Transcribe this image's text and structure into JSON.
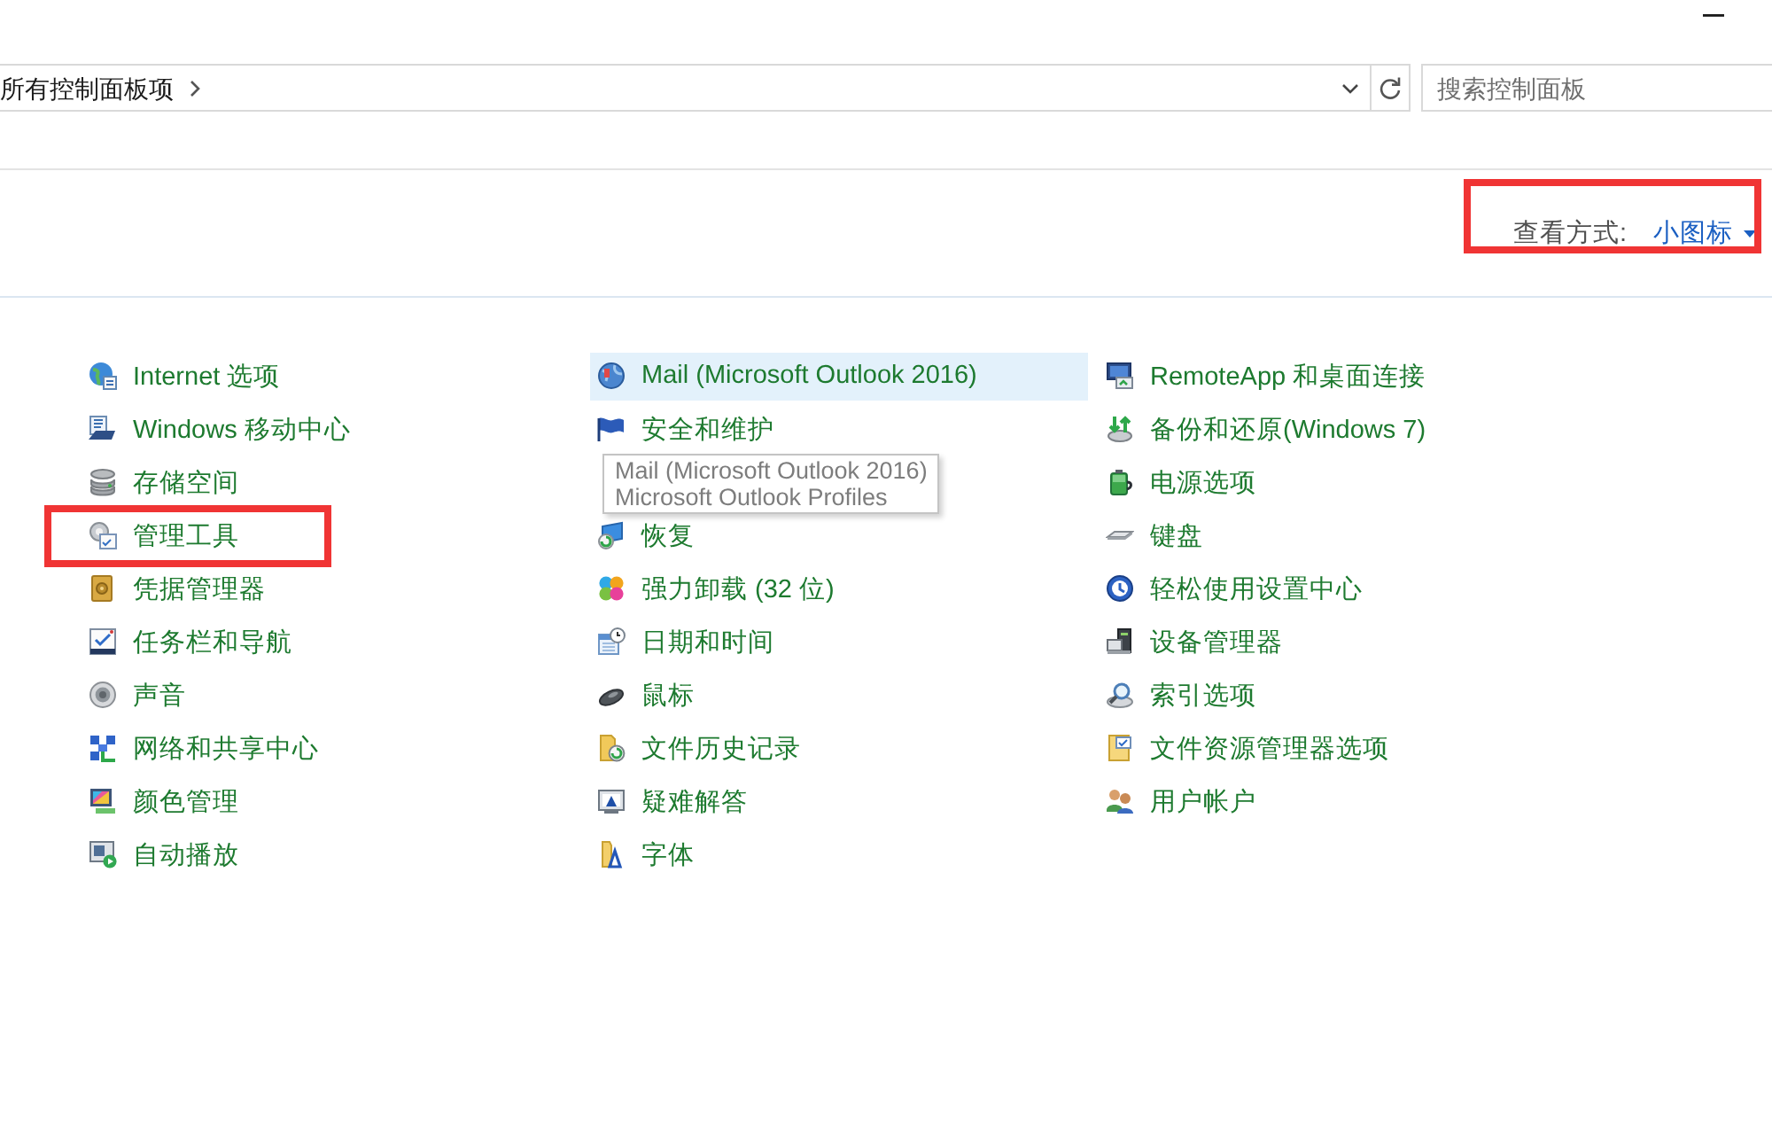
{
  "address_bar": {
    "breadcrumb": "所有控制面板项"
  },
  "search": {
    "placeholder": "搜索控制面板"
  },
  "view_by": {
    "label": "查看方式:",
    "value": "小图标",
    "marked": true
  },
  "columns": [
    {
      "items": [
        {
          "kind": "link",
          "label": "Internet 选项",
          "highlighted": false,
          "marked": false
        },
        {
          "kind": "link",
          "label": "Windows 移动中心",
          "highlighted": false,
          "marked": false
        },
        {
          "kind": "link",
          "label": "存储空间",
          "highlighted": false,
          "marked": false
        },
        {
          "kind": "link",
          "label": "管理工具",
          "highlighted": false,
          "marked": true
        },
        {
          "kind": "link",
          "label": "凭据管理器",
          "highlighted": false,
          "marked": false
        },
        {
          "kind": "link",
          "label": "任务栏和导航",
          "highlighted": false,
          "marked": false
        },
        {
          "kind": "link",
          "label": "声音",
          "highlighted": false,
          "marked": false
        },
        {
          "kind": "link",
          "label": "网络和共享中心",
          "highlighted": false,
          "marked": false
        },
        {
          "kind": "link",
          "label": "颜色管理",
          "highlighted": false,
          "marked": false
        },
        {
          "kind": "link",
          "label": "自动播放",
          "highlighted": false,
          "marked": false
        }
      ]
    },
    {
      "items": [
        {
          "kind": "link",
          "label": "Mail (Microsoft Outlook 2016)",
          "highlighted": true,
          "marked": false
        },
        {
          "kind": "link",
          "label": "安全和维护",
          "highlighted": false,
          "marked": false
        },
        {
          "kind": "tooltip",
          "lines": [
            "Mail (Microsoft Outlook 2016)",
            "Microsoft Outlook Profiles"
          ]
        },
        {
          "kind": "link",
          "label": "恢复",
          "highlighted": false,
          "marked": false
        },
        {
          "kind": "link",
          "label": "强力卸载 (32 位)",
          "highlighted": false,
          "marked": false
        },
        {
          "kind": "link",
          "label": "日期和时间",
          "highlighted": false,
          "marked": false
        },
        {
          "kind": "link",
          "label": "鼠标",
          "highlighted": false,
          "marked": false
        },
        {
          "kind": "link",
          "label": "文件历史记录",
          "highlighted": false,
          "marked": false
        },
        {
          "kind": "link",
          "label": "疑难解答",
          "highlighted": false,
          "marked": false
        },
        {
          "kind": "link",
          "label": "字体",
          "highlighted": false,
          "marked": false
        }
      ]
    },
    {
      "items": [
        {
          "kind": "link",
          "label": "RemoteApp 和桌面连接",
          "highlighted": false,
          "marked": false
        },
        {
          "kind": "link",
          "label": "备份和还原(Windows 7)",
          "highlighted": false,
          "marked": false
        },
        {
          "kind": "link",
          "label": "电源选项",
          "highlighted": false,
          "marked": false
        },
        {
          "kind": "link",
          "label": "键盘",
          "highlighted": false,
          "marked": false
        },
        {
          "kind": "link",
          "label": "轻松使用设置中心",
          "highlighted": false,
          "marked": false
        },
        {
          "kind": "link",
          "label": "设备管理器",
          "highlighted": false,
          "marked": false
        },
        {
          "kind": "link",
          "label": "索引选项",
          "highlighted": false,
          "marked": false
        },
        {
          "kind": "link",
          "label": "文件资源管理器选项",
          "highlighted": false,
          "marked": false
        },
        {
          "kind": "link",
          "label": "用户帐户",
          "highlighted": false,
          "marked": false
        }
      ]
    }
  ]
}
